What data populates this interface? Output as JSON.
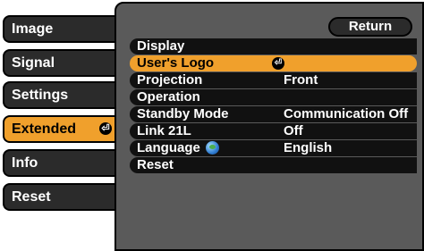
{
  "sidebar": {
    "tabs": [
      {
        "label": "Image"
      },
      {
        "label": "Signal"
      },
      {
        "label": "Settings"
      },
      {
        "label": "Extended"
      },
      {
        "label": "Info"
      },
      {
        "label": "Reset"
      }
    ],
    "active_index": 3,
    "enter_glyph": "⏎"
  },
  "panel": {
    "return_label": "Return",
    "enter_glyph": "⏎",
    "items": [
      {
        "label": "Display",
        "value": ""
      },
      {
        "label": "User's Logo",
        "value": ""
      },
      {
        "label": "Projection",
        "value": "Front"
      },
      {
        "label": "Operation",
        "value": ""
      },
      {
        "label": "Standby Mode",
        "value": "Communication Off"
      },
      {
        "label": "Link 21L",
        "value": "Off"
      },
      {
        "label": "Language",
        "value": "English"
      },
      {
        "label": "Reset",
        "value": ""
      }
    ],
    "selected_index": 1
  },
  "colors": {
    "accent": "#f0a02c",
    "panel": "#5a5a5a",
    "row": "#111111",
    "tab": "#2b2b2b"
  },
  "icons": {
    "enter": "enter-icon",
    "language": "globe-icon"
  }
}
